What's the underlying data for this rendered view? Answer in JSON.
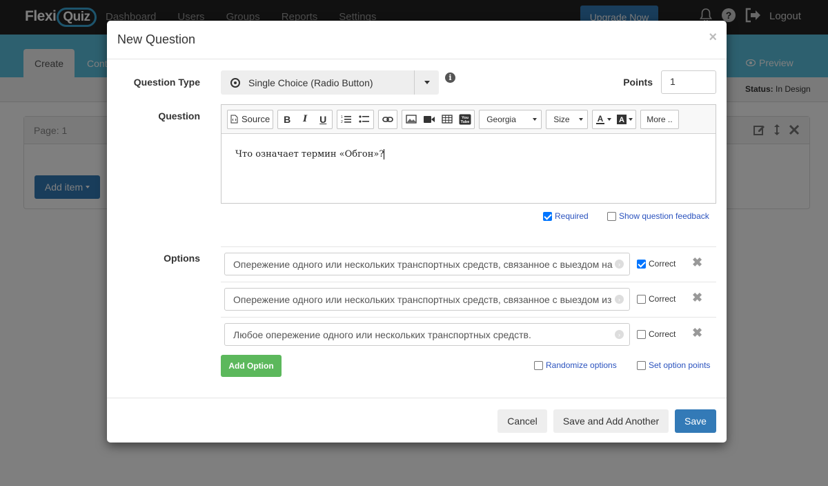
{
  "app": {
    "logo": "FlexiQuiz",
    "nav": [
      "Dashboard",
      "Users",
      "Groups",
      "Reports",
      "Settings"
    ],
    "upgrade_label": "Upgrade Now",
    "logout_label": "Logout",
    "tab_create": "Create",
    "tab_cont": "Cont",
    "preview_label": "Preview",
    "status_label": "Status:",
    "status_value": "In Design",
    "page_label": "Page: 1",
    "add_item_label": "Add item"
  },
  "modal": {
    "title": "New Question",
    "close": "×",
    "question_type_label": "Question Type",
    "question_type_value": "Single Choice (Radio Button)",
    "points_label": "Points",
    "points_value": "1",
    "question_label": "Question",
    "toolbar": {
      "source": "Source",
      "font": "Georgia",
      "size": "Size",
      "more": "More .."
    },
    "question_text": "Что означает термин «Обгон»?",
    "required_label": "Required",
    "required_checked": true,
    "feedback_label": "Show question feedback",
    "feedback_checked": false,
    "options_label": "Options",
    "options": [
      {
        "text": "Опережение одного или нескольких транспортных средств, связанное с выездом на",
        "correct": true
      },
      {
        "text": "Опережение одного или нескольких транспортных средств, связанное с выездом из",
        "correct": false
      },
      {
        "text": "Любое опережение одного или нескольких транспортных средств.",
        "correct": false
      }
    ],
    "correct_label": "Correct",
    "add_option_label": "Add Option",
    "randomize_label": "Randomize options",
    "set_points_label": "Set option points",
    "cancel_label": "Cancel",
    "save_add_label": "Save and Add Another",
    "save_label": "Save"
  }
}
